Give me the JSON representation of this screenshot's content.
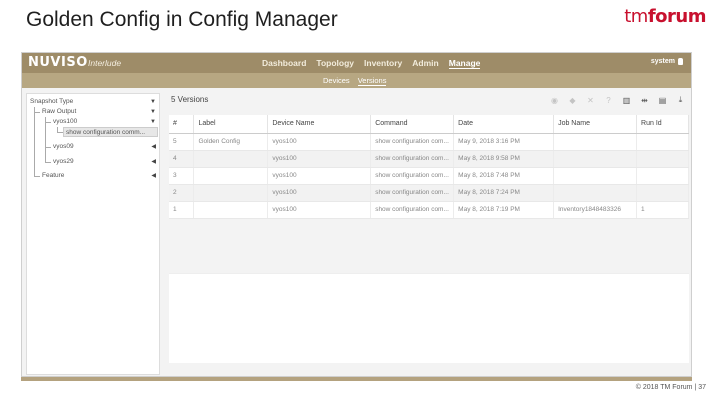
{
  "slide": {
    "title": "Golden Config in Config Manager"
  },
  "logo": {
    "tm": "tm",
    "forum": "forum"
  },
  "app": {
    "brand": "NUVISO",
    "subtitle": "Interlude",
    "nav": [
      "Dashboard",
      "Topology",
      "Inventory",
      "Admin",
      "Manage"
    ],
    "nav_active": "Manage",
    "user": "system",
    "subnav": [
      "Devices",
      "Versions"
    ],
    "subnav_active": "Versions"
  },
  "tree": {
    "header": "Snapshot Type",
    "items": [
      {
        "label": "Raw Output"
      },
      {
        "label": "vyos100"
      },
      {
        "label": "show configuration comm..."
      },
      {
        "label": "vyos09"
      },
      {
        "label": "vyos29"
      },
      {
        "label": "Feature"
      }
    ]
  },
  "versions": {
    "heading": "5 Versions",
    "tool_icons": [
      "eye-icon",
      "tag-icon",
      "close-icon",
      "help-icon",
      "columns-icon",
      "compare-icon",
      "print-icon",
      "download-icon"
    ],
    "columns": [
      "#",
      "Label",
      "Device Name",
      "Command",
      "Date",
      "Job Name",
      "Run Id"
    ],
    "rows": [
      [
        "5",
        "Golden Config",
        "vyos100",
        "show configuration com...",
        "May 9, 2018 3:16 PM",
        "",
        ""
      ],
      [
        "4",
        "",
        "vyos100",
        "show configuration com...",
        "May 8, 2018 9:58 PM",
        "",
        ""
      ],
      [
        "3",
        "",
        "vyos100",
        "show configuration com...",
        "May 8, 2018 7:48 PM",
        "",
        ""
      ],
      [
        "2",
        "",
        "vyos100",
        "show configuration com...",
        "May 8, 2018 7:24 PM",
        "",
        ""
      ],
      [
        "1",
        "",
        "vyos100",
        "show configuration com...",
        "May 8, 2018 7:19 PM",
        "Inventory1848483326",
        "1"
      ]
    ]
  },
  "footer": {
    "text": "© 2018 TM Forum | 37"
  }
}
